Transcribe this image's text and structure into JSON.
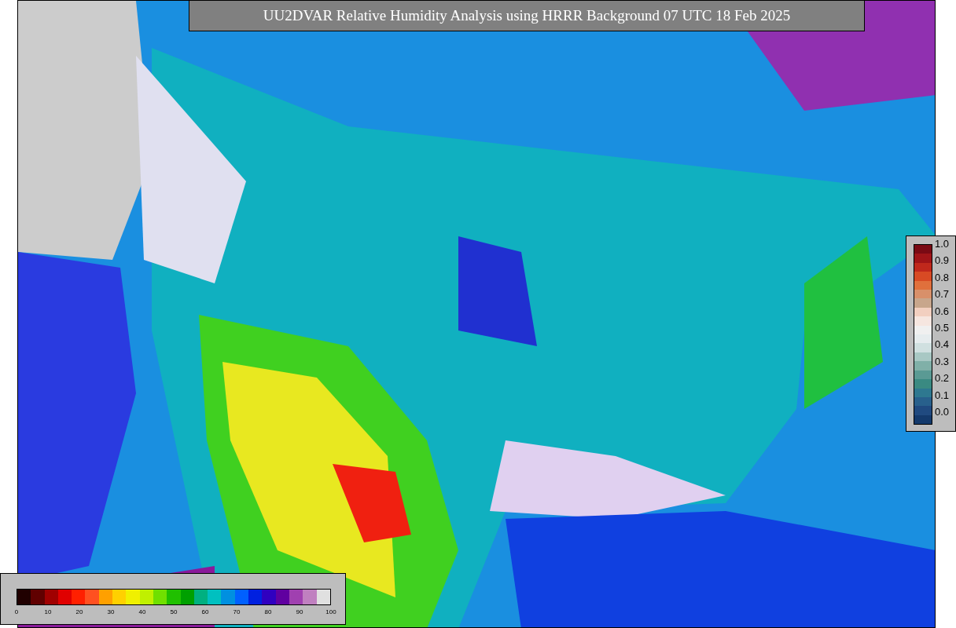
{
  "title": "UU2DVAR Relative Humidity Analysis using HRRR Background 07 UTC 18 Feb 2025",
  "ratio_colorbar": {
    "ticks": [
      "1.0",
      "0.9",
      "0.8",
      "0.7",
      "0.6",
      "0.5",
      "0.4",
      "0.3",
      "0.2",
      "0.1",
      "0.0"
    ]
  },
  "humidity_colorbar": {
    "ticks": [
      "0",
      "10",
      "20",
      "30",
      "40",
      "50",
      "60",
      "70",
      "80",
      "90",
      "100"
    ]
  }
}
